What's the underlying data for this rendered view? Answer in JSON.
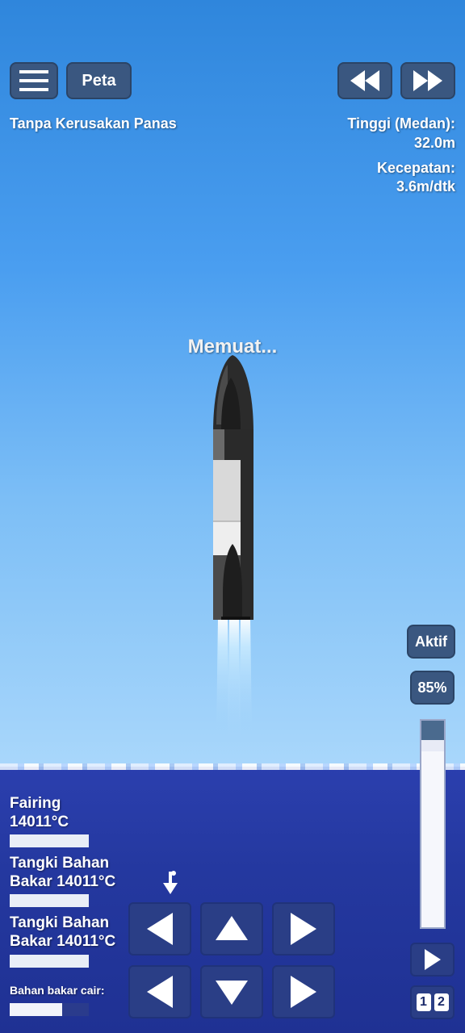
{
  "top_bar": {
    "menu_label": "",
    "map_label": "Peta",
    "rewind_label": "",
    "fast_forward_label": ""
  },
  "status": {
    "heat_mode": "Tanpa Kerusakan Panas",
    "altitude_label": "Tinggi (Medan):",
    "altitude_value": "32.0m",
    "velocity_label": "Kecepatan:",
    "velocity_value": "3.6m/dtk"
  },
  "center_message": "Memuat...",
  "throttle": {
    "active_label": "Aktif",
    "percent_label": "85%",
    "level": 0.85
  },
  "parts": [
    {
      "name": "Fairing",
      "temperature": "14011°C",
      "heat_level": 1.0
    },
    {
      "name": "Tangki Bahan Bakar 14011°C",
      "heat_level": 1.0
    },
    {
      "name": "Tangki Bahan Bakar 14011°C",
      "heat_level": 1.0
    }
  ],
  "fuel": {
    "label": "Bahan bakar cair:",
    "level": 0.66
  },
  "stage_buttons": {
    "one": "1",
    "two": "2"
  },
  "colors": {
    "sky": "#4a9ef0",
    "sea": "#24389f",
    "button": "#3a5780"
  }
}
